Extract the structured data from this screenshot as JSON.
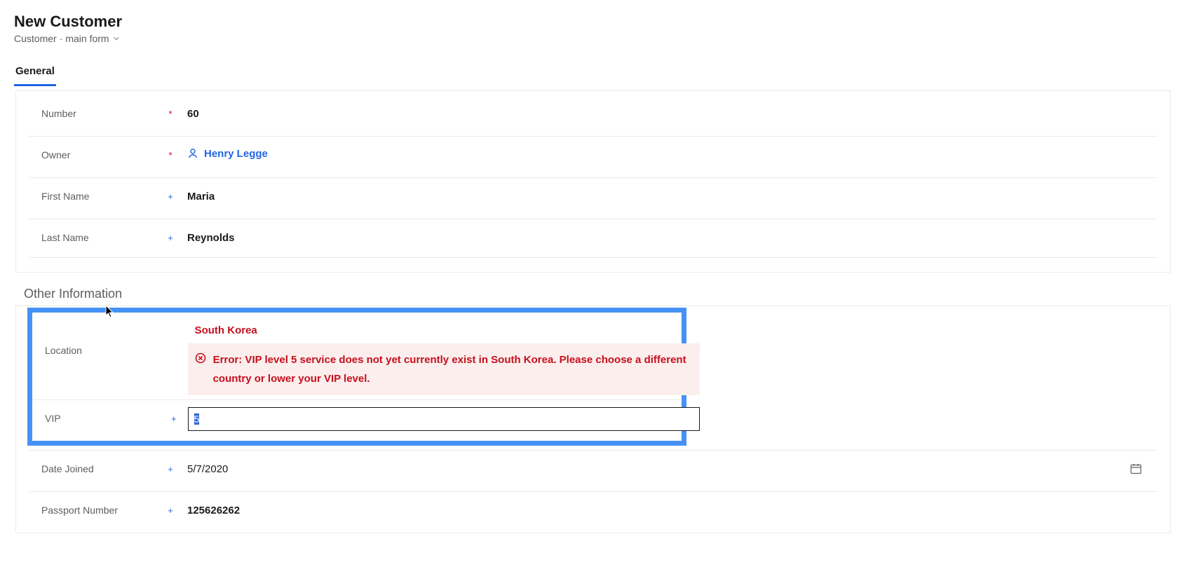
{
  "header": {
    "title": "New Customer",
    "entity": "Customer",
    "separator": "·",
    "form_selector": "main form"
  },
  "tabs": {
    "general": "General"
  },
  "general": {
    "number": {
      "label": "Number",
      "value": "60",
      "marker": "*"
    },
    "owner": {
      "label": "Owner",
      "value": "Henry Legge",
      "marker": "*"
    },
    "first_name": {
      "label": "First Name",
      "value": "Maria",
      "marker": "+"
    },
    "last_name": {
      "label": "Last Name",
      "value": "Reynolds",
      "marker": "+"
    }
  },
  "other": {
    "section_title": "Other Information",
    "location": {
      "label": "Location",
      "value": "South Korea",
      "error": "Error: VIP level 5 service does not yet currently exist in South Korea. Please choose a different country or lower your VIP level."
    },
    "vip": {
      "label": "VIP",
      "value": "5",
      "marker": "+"
    },
    "date_joined": {
      "label": "Date Joined",
      "value": "5/7/2020",
      "marker": "+"
    },
    "passport": {
      "label": "Passport Number",
      "value": "125626262",
      "marker": "+"
    }
  }
}
